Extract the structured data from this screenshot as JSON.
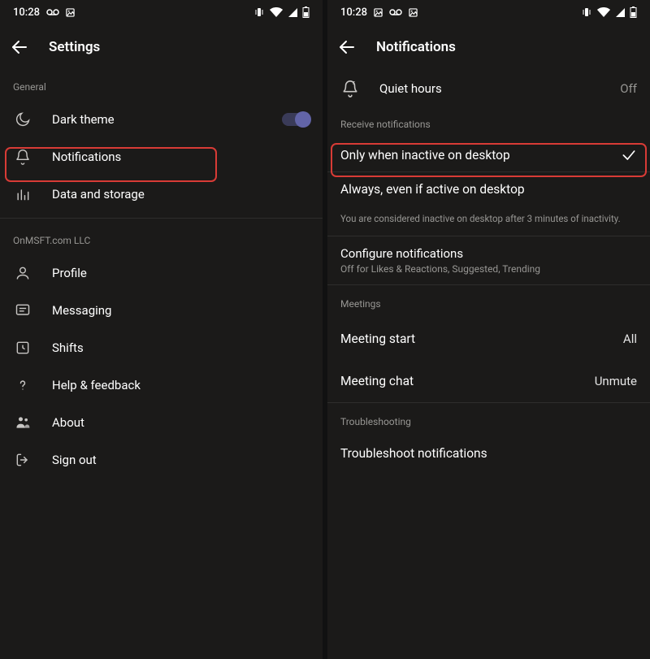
{
  "status": {
    "time": "10:28"
  },
  "left": {
    "title": "Settings",
    "sections": [
      {
        "heading": "General",
        "items": [
          {
            "icon": "moon",
            "label": "Dark theme",
            "toggle": true
          },
          {
            "icon": "bell",
            "label": "Notifications",
            "highlighted": true
          },
          {
            "icon": "bars",
            "label": "Data and storage"
          }
        ]
      },
      {
        "heading": "OnMSFT.com LLC",
        "items": [
          {
            "icon": "person",
            "label": "Profile"
          },
          {
            "icon": "message",
            "label": "Messaging"
          },
          {
            "icon": "clock",
            "label": "Shifts"
          },
          {
            "icon": "help",
            "label": "Help & feedback"
          },
          {
            "icon": "teams",
            "label": "About"
          },
          {
            "icon": "signout",
            "label": "Sign out"
          }
        ]
      }
    ]
  },
  "right": {
    "title": "Notifications",
    "quiet_hours": {
      "label": "Quiet hours",
      "value": "Off"
    },
    "receive_heading": "Receive notifications",
    "receive_options": [
      {
        "label": "Only when inactive on desktop",
        "selected": true,
        "highlighted": true
      },
      {
        "label": "Always, even if active on desktop",
        "selected": false
      }
    ],
    "inactive_note": "You are considered inactive on desktop after 3 minutes of inactivity.",
    "configure": {
      "label": "Configure notifications",
      "sub": "Off for Likes & Reactions, Suggested, Trending"
    },
    "meetings_heading": "Meetings",
    "meetings": [
      {
        "label": "Meeting start",
        "value": "All"
      },
      {
        "label": "Meeting chat",
        "value": "Unmute"
      }
    ],
    "troubleshoot_heading": "Troubleshooting",
    "troubleshoot_label": "Troubleshoot notifications"
  }
}
